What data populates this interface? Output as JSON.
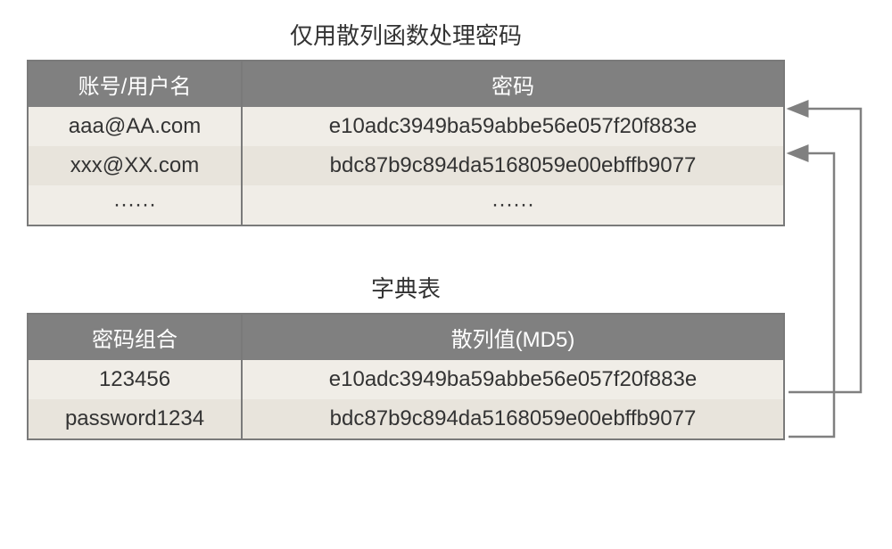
{
  "table1": {
    "title": "仅用散列函数处理密码",
    "header1": "账号/用户名",
    "header2": "密码",
    "r1c1": "aaa@AA.com",
    "r1c2": "e10adc3949ba59abbe56e057f20f883e",
    "r2c1": "xxx@XX.com",
    "r2c2": "bdc87b9c894da5168059e00ebffb9077",
    "r3c1": "······",
    "r3c2": "······"
  },
  "table2": {
    "title": "字典表",
    "header1": "密码组合",
    "header2": "散列值(MD5)",
    "r1c1": "123456",
    "r1c2": "e10adc3949ba59abbe56e057f20f883e",
    "r2c1": "password1234",
    "r2c2": "bdc87b9c894da5168059e00ebffb9077"
  }
}
